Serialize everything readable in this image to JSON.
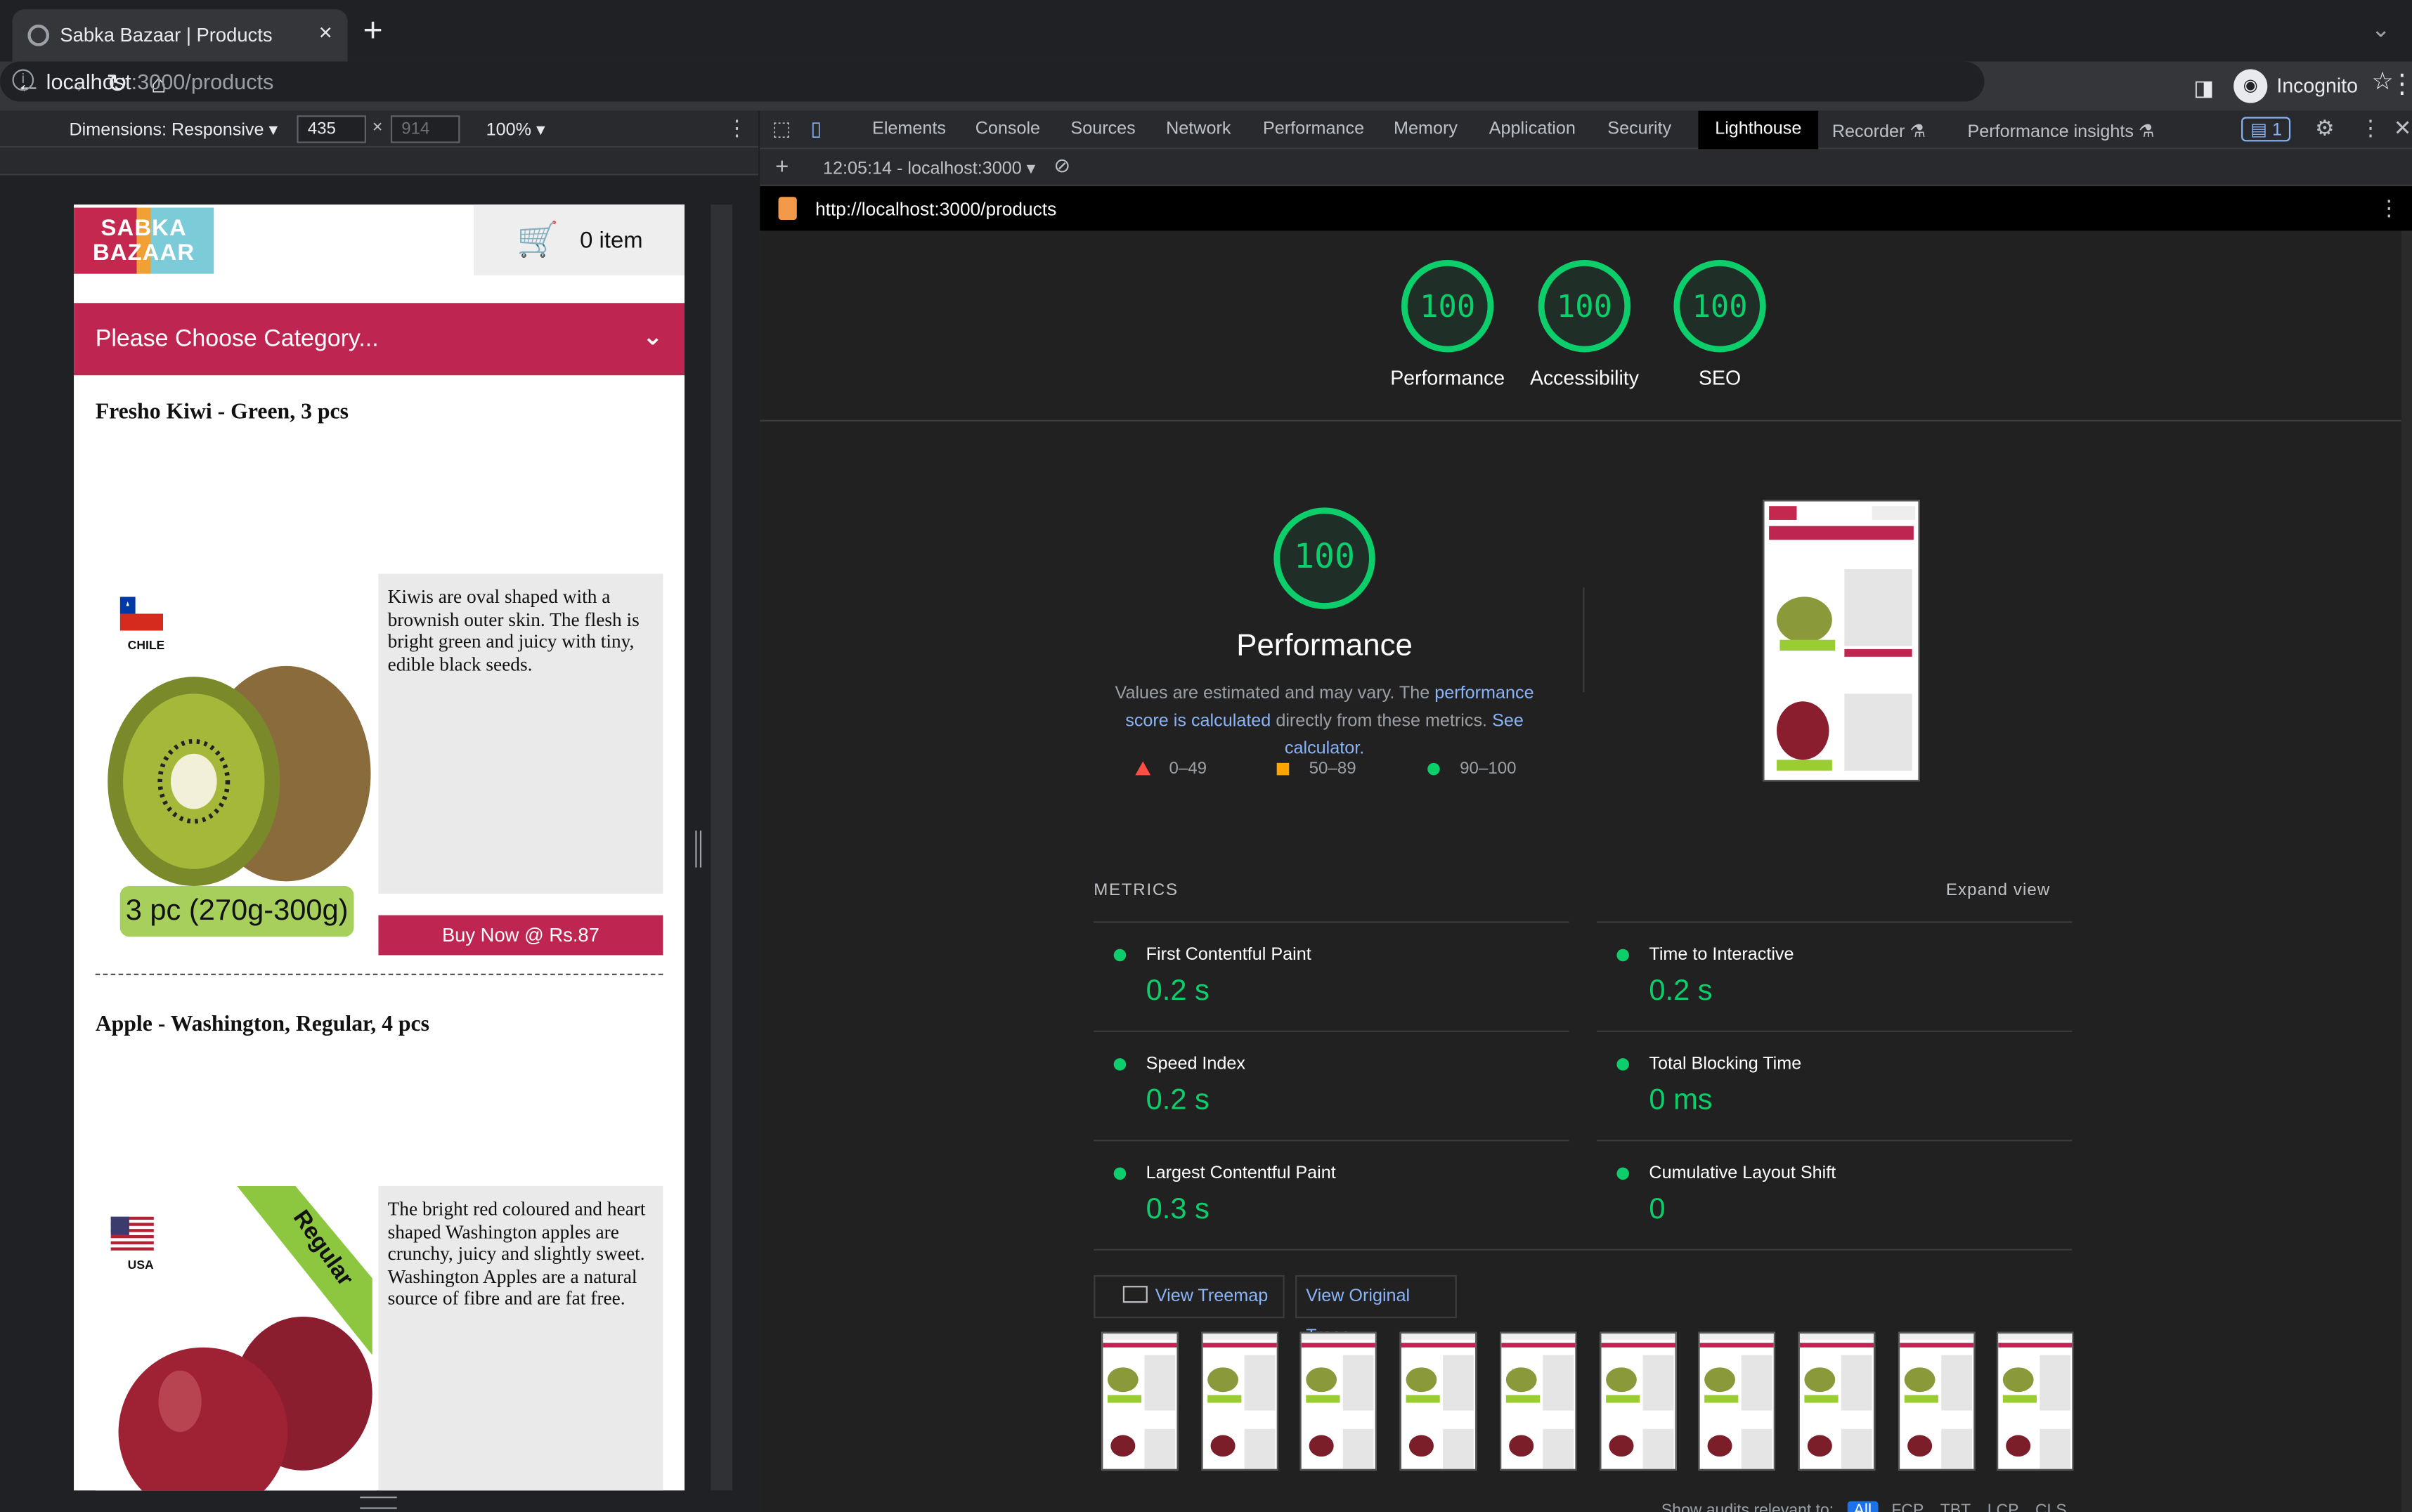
{
  "browser": {
    "tab_title": "Sabka Bazaar | Products",
    "url_host": "localhost",
    "url_path": ":3000/products",
    "profile_label": "Incognito"
  },
  "device_toolbar": {
    "dimensions_label": "Dimensions: Responsive ▾",
    "width": "435",
    "height": "914",
    "times": "×",
    "zoom": "100% ▾"
  },
  "page": {
    "logo_text": "SABKA BAZAAR",
    "cart_label": "0 item",
    "category_placeholder": "Please Choose Category...",
    "products": [
      {
        "title": "Fresho Kiwi - Green, 3 pcs",
        "country": "CHILE",
        "pack_label": "3 pc (270g-300g)",
        "description": "Kiwis are oval shaped with a brownish outer skin. The flesh is bright green and juicy with tiny, edible black seeds.",
        "buy_label": "Buy Now @ Rs.87"
      },
      {
        "title": "Apple - Washington, Regular, 4 pcs",
        "country": "USA",
        "ribbon": "Regular",
        "description": "The bright red coloured and heart shaped Washington apples are crunchy, juicy and slightly sweet. Washington Apples are a natural source of fibre and are fat free."
      }
    ]
  },
  "devtools": {
    "tabs": [
      "Elements",
      "Console",
      "Sources",
      "Network",
      "Performance",
      "Memory",
      "Application",
      "Security",
      "Lighthouse",
      "Recorder ⚗",
      "Performance insights ⚗"
    ],
    "issues_badge": "1",
    "report_selector": "12:05:14 - localhost:3000 ▾",
    "report_url": "http://localhost:3000/products"
  },
  "lighthouse": {
    "scores": [
      {
        "label": "Performance",
        "value": "100"
      },
      {
        "label": "Accessibility",
        "value": "100"
      },
      {
        "label": "SEO",
        "value": "100"
      }
    ],
    "main_score": "100",
    "main_label": "Performance",
    "note_prefix": "Values are estimated and may vary. The ",
    "note_link1": "performance score is calculated",
    "note_mid": " directly from these metrics. ",
    "note_link2": "See calculator.",
    "legend": [
      {
        "range": "0–49",
        "color": "#ff4e42"
      },
      {
        "range": "50–89",
        "color": "#ffa400"
      },
      {
        "range": "90–100",
        "color": "#0cce6b"
      }
    ],
    "metrics_heading": "METRICS",
    "expand_label": "Expand view",
    "metrics": [
      {
        "name": "First Contentful Paint",
        "value": "0.2 s"
      },
      {
        "name": "Time to Interactive",
        "value": "0.2 s"
      },
      {
        "name": "Speed Index",
        "value": "0.2 s"
      },
      {
        "name": "Total Blocking Time",
        "value": "0 ms"
      },
      {
        "name": "Largest Contentful Paint",
        "value": "0.3 s"
      },
      {
        "name": "Cumulative Layout Shift",
        "value": "0"
      }
    ],
    "view_treemap": "View Treemap",
    "view_trace": "View Original Trace",
    "filter_label": "Show audits relevant to:",
    "filters": [
      "All",
      "FCP",
      "TBT",
      "LCP",
      "CLS"
    ]
  },
  "colors": {
    "accent": "#be2651",
    "pass": "#0cce6b",
    "link": "#8ab4f8"
  }
}
